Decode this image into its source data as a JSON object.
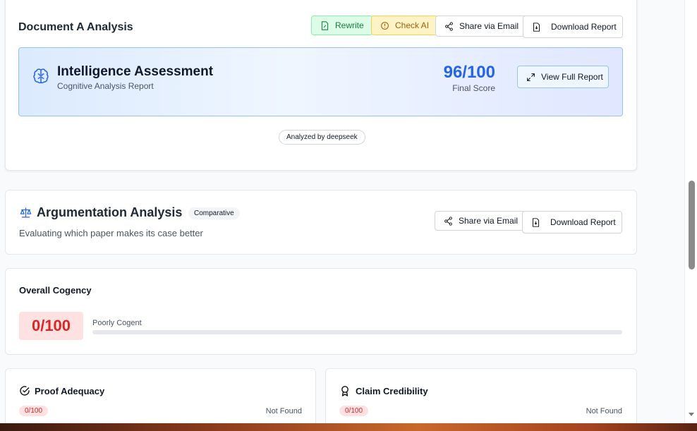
{
  "doc": {
    "title": "Document A Analysis",
    "rewrite_label": "Rewrite",
    "check_ai_label": "Check AI",
    "share_label": "Share via Email",
    "download_label": "Download Report"
  },
  "assessment": {
    "title": "Intelligence Assessment",
    "subtitle": "Cognitive Analysis Report",
    "score": "96/100",
    "score_label": "Final Score",
    "view_label": "View Full Report",
    "analyzed_by": "Analyzed by deepseek"
  },
  "argumentation": {
    "title": "Argumentation Analysis",
    "badge": "Comparative",
    "subtitle": "Evaluating which paper makes its case better",
    "share_label": "Share via Email",
    "download_label": "Download Report"
  },
  "cogency": {
    "title": "Overall Cogency",
    "score": "0/100",
    "rating": "Poorly Cogent",
    "progress": 0
  },
  "proof": {
    "title": "Proof Adequacy",
    "score": "0/100",
    "status": "Not Found"
  },
  "claim": {
    "title": "Claim Credibility",
    "score": "0/100",
    "status": "Not Found"
  },
  "colors": {
    "accent_blue": "#2563eb",
    "score_red": "#dc2626",
    "rewrite_green": "#15803d",
    "check_ai_amber": "#a16207"
  },
  "icons": [
    "rewrite-icon",
    "check-ai-icon",
    "share-icon",
    "download-icon",
    "brain-icon",
    "expand-icon",
    "scale-icon",
    "check-circle-icon",
    "award-icon"
  ]
}
